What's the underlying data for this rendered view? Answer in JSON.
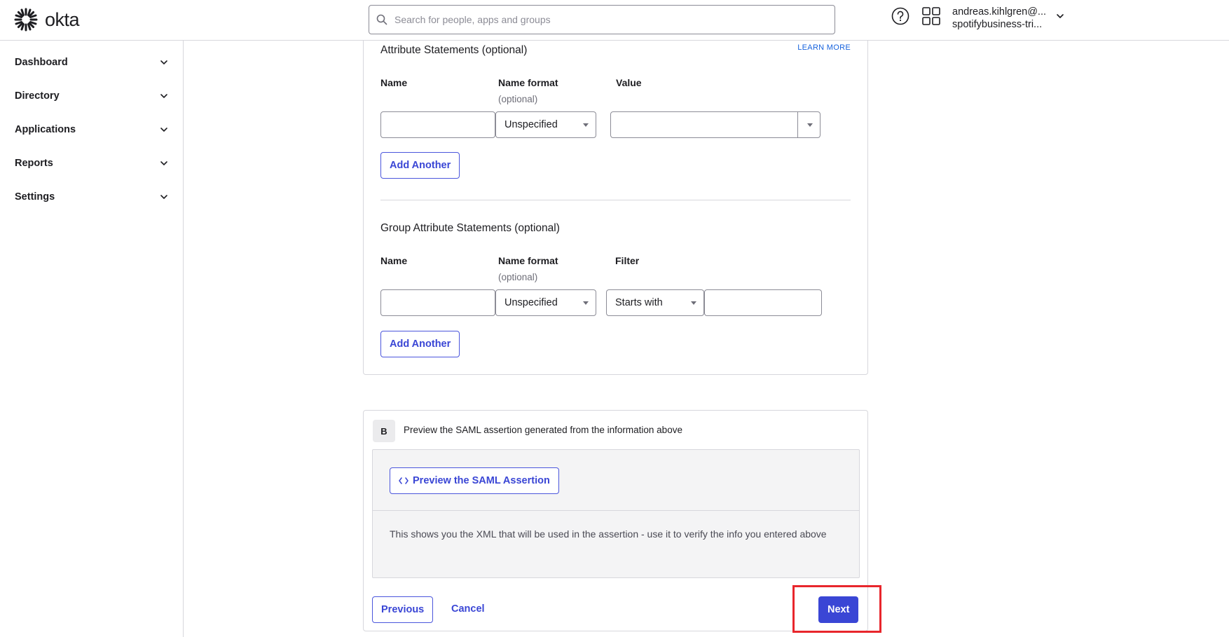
{
  "header": {
    "logo_text": "okta",
    "search_placeholder": "Search for people, apps and groups",
    "user_name": "andreas.kihlgren@...",
    "user_org": "spotifybusiness-tri..."
  },
  "sidebar": {
    "items": [
      {
        "label": "Dashboard"
      },
      {
        "label": "Directory"
      },
      {
        "label": "Applications"
      },
      {
        "label": "Reports"
      },
      {
        "label": "Settings"
      }
    ]
  },
  "attribute_statements": {
    "title": "Attribute Statements (optional)",
    "learn_more": "LEARN MORE",
    "col_name": "Name",
    "col_format": "Name format",
    "col_format_sub": "(optional)",
    "col_value": "Value",
    "name_value": "",
    "format_selected": "Unspecified",
    "value_value": "",
    "add_another": "Add Another"
  },
  "group_attribute_statements": {
    "title": "Group Attribute Statements (optional)",
    "col_name": "Name",
    "col_format": "Name format",
    "col_format_sub": "(optional)",
    "col_filter": "Filter",
    "name_value": "",
    "format_selected": "Unspecified",
    "filter_selected": "Starts with",
    "filter_value": "",
    "add_another": "Add Another"
  },
  "preview": {
    "badge": "B",
    "title": "Preview the SAML assertion generated from the information above",
    "button_label": "Preview the SAML Assertion",
    "description": "This shows you the XML that will be used in the assertion - use it to verify the info you entered above"
  },
  "footer": {
    "previous": "Previous",
    "cancel": "Cancel",
    "next": "Next"
  },
  "colors": {
    "accent": "#3a46d5",
    "highlight": "#e8262c"
  }
}
